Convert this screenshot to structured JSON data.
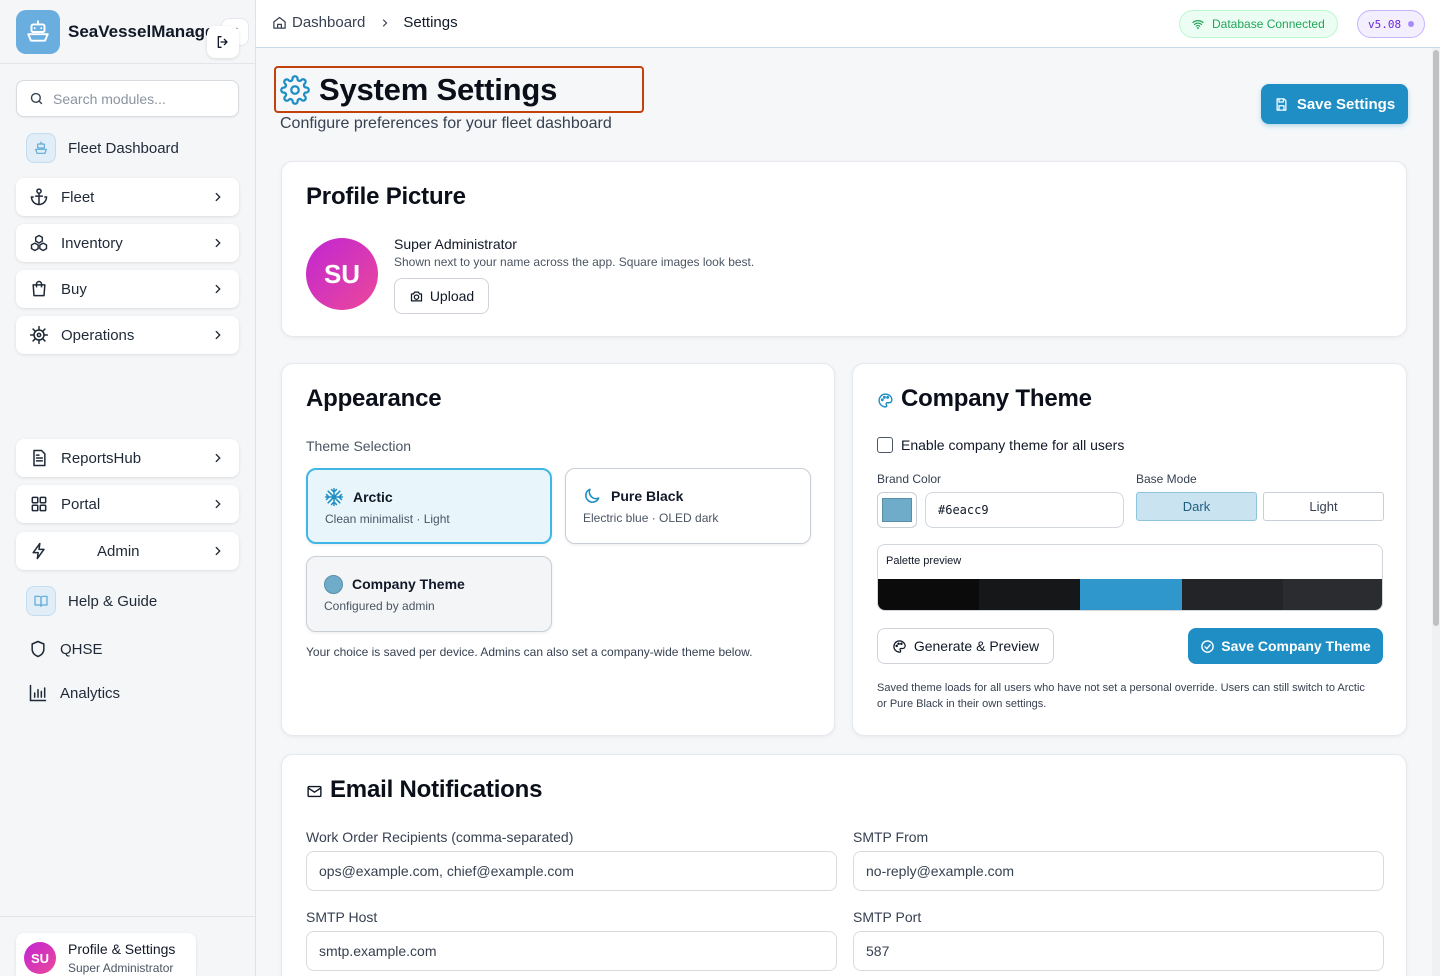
{
  "app": {
    "name": "SeaVesselManager"
  },
  "sidebar": {
    "search_placeholder": "Search modules...",
    "items": [
      {
        "label": "Fleet Dashboard",
        "icon": "ship-icon"
      },
      {
        "label": "Fleet",
        "icon": "anchor-icon"
      },
      {
        "label": "Inventory",
        "icon": "boxes-icon"
      },
      {
        "label": "Buy",
        "icon": "shopping-bag-icon"
      },
      {
        "label": "Operations",
        "icon": "cog-icon"
      },
      {
        "label": "ReportsHub",
        "icon": "file-text-icon"
      },
      {
        "label": "Portal",
        "icon": "grid-icon"
      },
      {
        "label": "Admin",
        "icon": "zap-icon"
      },
      {
        "label": "Help & Guide",
        "icon": "book-icon"
      },
      {
        "label": "QHSE",
        "icon": "shield-icon"
      },
      {
        "label": "Analytics",
        "icon": "bar-chart-icon"
      }
    ],
    "profile": {
      "initials": "SU",
      "name": "Profile & Settings",
      "role": "Super Administrator"
    }
  },
  "topbar": {
    "breadcrumb": [
      "Dashboard",
      "Settings"
    ],
    "db_status": "Database Connected",
    "version": "v5.08"
  },
  "page": {
    "title": "System Settings",
    "subtitle": "Configure preferences for your fleet dashboard",
    "save_label": "Save Settings"
  },
  "profile_picture": {
    "heading": "Profile Picture",
    "initials": "SU",
    "name": "Super Administrator",
    "hint": "Shown next to your name across the app. Square images look best.",
    "upload_label": "Upload"
  },
  "appearance": {
    "heading": "Appearance",
    "theme_label": "Theme Selection",
    "options": [
      {
        "title": "Arctic",
        "sub": "Clean minimalist · Light",
        "selected": true
      },
      {
        "title": "Pure Black",
        "sub": "Electric blue · OLED dark",
        "selected": false
      },
      {
        "title": "Company Theme",
        "sub": "Configured by admin",
        "selected": false
      }
    ],
    "note": "Your choice is saved per device. Admins can also set a company-wide theme below."
  },
  "company_theme": {
    "heading": "Company Theme",
    "enable_label": "Enable company theme for all users",
    "enabled": false,
    "brand_color_label": "Brand Color",
    "brand_color": "#6eacc9",
    "base_mode_label": "Base Mode",
    "modes": [
      "Dark",
      "Light"
    ],
    "selected_mode": "Dark",
    "palette_label": "Palette preview",
    "palette": [
      "#0b0b0c",
      "#161718",
      "#2f97cc",
      "#232427",
      "#2b2c2f"
    ],
    "generate_label": "Generate & Preview",
    "save_label": "Save Company Theme",
    "note": "Saved theme loads for all users who have not set a personal override. Users can still switch to Arctic or Pure Black in their own settings."
  },
  "email": {
    "heading": "Email Notifications",
    "fields": [
      {
        "label": "Work Order Recipients (comma-separated)",
        "value": "ops@example.com, chief@example.com"
      },
      {
        "label": "SMTP From",
        "value": "no-reply@example.com"
      },
      {
        "label": "SMTP Host",
        "value": "smtp.example.com"
      },
      {
        "label": "SMTP Port",
        "value": "587"
      }
    ]
  },
  "colors": {
    "accent": "#1e8ec4",
    "title_highlight": "#c2410c",
    "success": "#22a55a"
  }
}
